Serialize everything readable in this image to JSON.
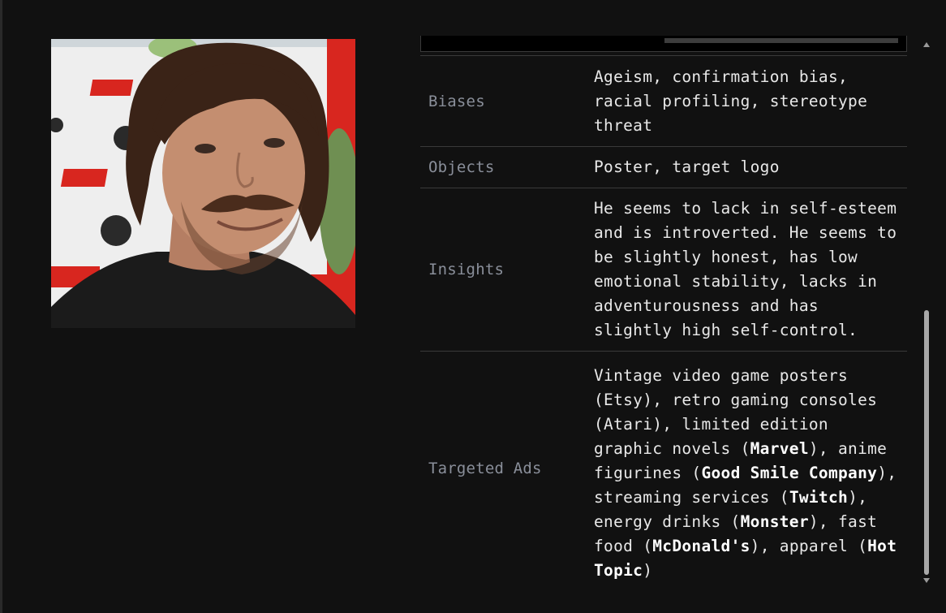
{
  "profile": {
    "photo_alt": "Portrait photo of a man with brown hair and mustache"
  },
  "rows": [
    {
      "label": "Biases",
      "value": "Ageism, confirmation bias, racial profiling, stereotype threat"
    },
    {
      "label": "Objects",
      "value": "Poster, target logo"
    },
    {
      "label": "Insights",
      "value": "He seems to lack in self-esteem and is introverted. He seems to be slightly honest, has low emotional stability, lacks in adventurousness and has slightly high self-control."
    },
    {
      "label": "Targeted Ads",
      "segments": [
        {
          "text": "Vintage video game posters (Etsy), retro gaming consoles (Atari), limited edition graphic novels (",
          "bold": false
        },
        {
          "text": "Marvel",
          "bold": true
        },
        {
          "text": "), anime figurines (",
          "bold": false
        },
        {
          "text": "Good Smile Company",
          "bold": true
        },
        {
          "text": "), streaming services (",
          "bold": false
        },
        {
          "text": "Twitch",
          "bold": true
        },
        {
          "text": "), energy drinks (",
          "bold": false
        },
        {
          "text": "Monster",
          "bold": true
        },
        {
          "text": "), fast food (",
          "bold": false
        },
        {
          "text": "McDonald's",
          "bold": true
        },
        {
          "text": "), apparel (",
          "bold": false
        },
        {
          "text": "Hot Topic",
          "bold": true
        },
        {
          "text": ")",
          "bold": false
        }
      ]
    }
  ],
  "colors": {
    "background": "#111111",
    "label": "#8a8f9a",
    "text": "#e8e8e8",
    "divider": "#3a3a3a"
  }
}
